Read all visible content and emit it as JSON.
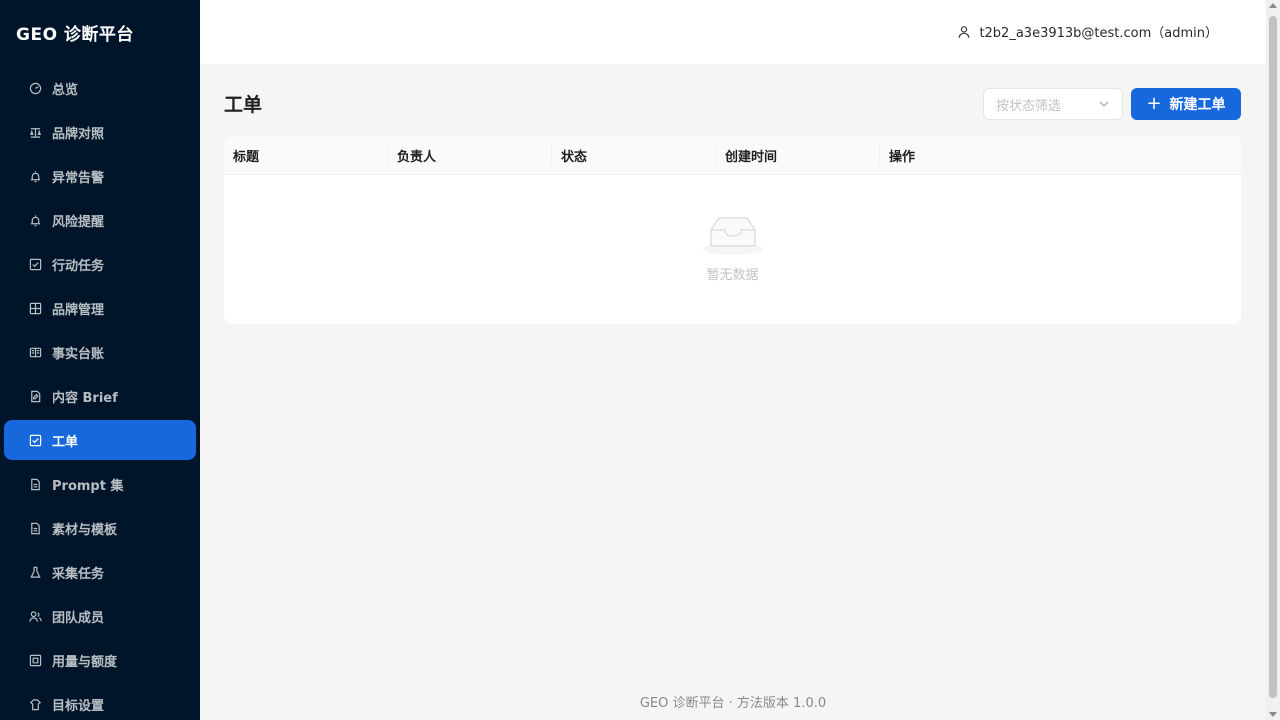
{
  "app": {
    "title": "GEO 诊断平台"
  },
  "sidebar": {
    "items": [
      {
        "label": "总览",
        "icon": "dashboard-icon",
        "active": false
      },
      {
        "label": "品牌对照",
        "icon": "compare-icon",
        "active": false
      },
      {
        "label": "异常告警",
        "icon": "alert-icon",
        "active": false
      },
      {
        "label": "风险提醒",
        "icon": "alert-icon",
        "active": false
      },
      {
        "label": "行动任务",
        "icon": "checkbox-icon",
        "active": false
      },
      {
        "label": "品牌管理",
        "icon": "grid-icon",
        "active": false
      },
      {
        "label": "事实台账",
        "icon": "ledger-icon",
        "active": false
      },
      {
        "label": "内容 Brief",
        "icon": "document-edit-icon",
        "active": false
      },
      {
        "label": "工单",
        "icon": "checkbox-icon",
        "active": true
      },
      {
        "label": "Prompt 集",
        "icon": "file-icon",
        "active": false
      },
      {
        "label": "素材与模板",
        "icon": "file-icon",
        "active": false
      },
      {
        "label": "采集任务",
        "icon": "flask-icon",
        "active": false
      },
      {
        "label": "团队成员",
        "icon": "team-icon",
        "active": false
      },
      {
        "label": "用量与额度",
        "icon": "quota-icon",
        "active": false
      },
      {
        "label": "目标设置",
        "icon": "target-icon",
        "active": false
      }
    ]
  },
  "header": {
    "user": "t2b2_a3e3913b@test.com（admin）"
  },
  "main": {
    "title": "工单",
    "filter_placeholder": "按状态筛选",
    "new_button": "新建工单",
    "columns": [
      "标题",
      "负责人",
      "状态",
      "创建时间",
      "操作"
    ],
    "rows": [],
    "empty_text": "暂无数据"
  },
  "footer": {
    "text": "GEO 诊断平台 · 方法版本 1.0.0"
  },
  "colors": {
    "sidebar_bg": "#001529",
    "primary": "#1668dc",
    "page_bg": "#f5f5f5"
  }
}
